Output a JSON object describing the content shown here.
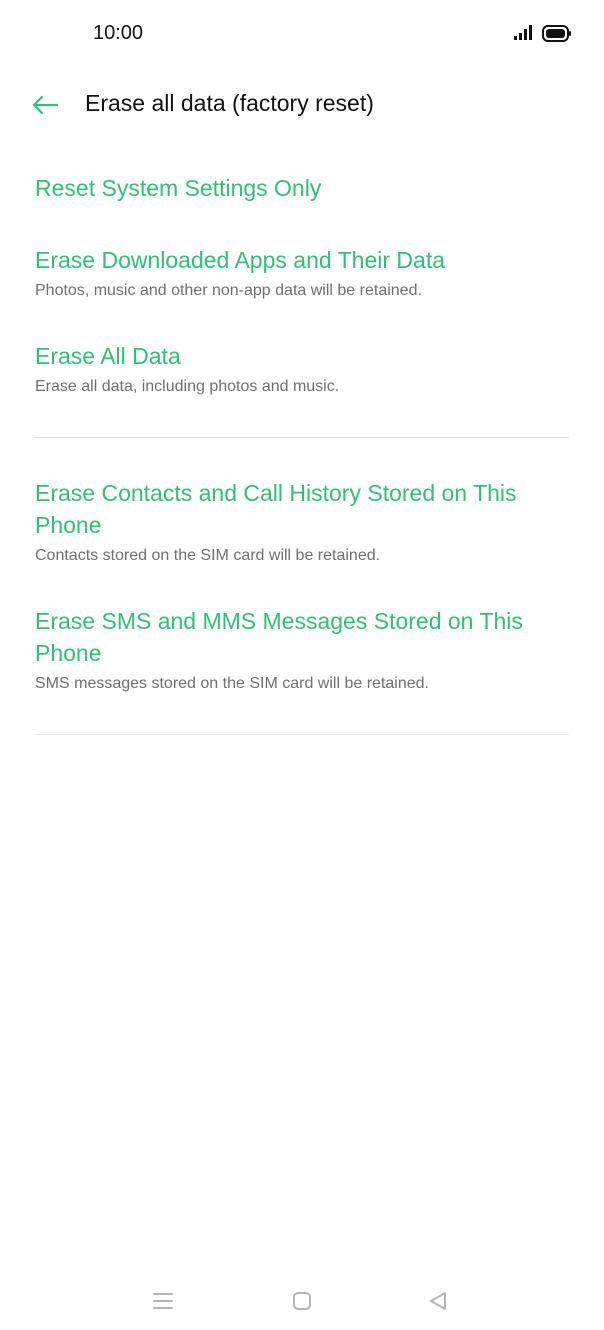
{
  "status_bar": {
    "time": "10:00",
    "icons": [
      "signal-icon",
      "battery-icon"
    ]
  },
  "header": {
    "title": "Erase all data (factory reset)",
    "back_icon": "arrow-left-icon"
  },
  "options": [
    {
      "title": "Reset System Settings Only",
      "description": ""
    },
    {
      "title": "Erase Downloaded Apps and Their Data",
      "description": "Photos, music and other non-app data will be retained."
    },
    {
      "title": "Erase All Data",
      "description": "Erase all data, including photos and music."
    },
    {
      "title": "Erase Contacts and Call History Stored on This Phone",
      "description": "Contacts stored on the SIM card will be retained."
    },
    {
      "title": "Erase SMS and MMS Messages Stored on This Phone",
      "description": "SMS messages stored on the SIM card will be retained."
    }
  ],
  "nav_bar": {
    "icons": [
      "menu-icon",
      "home-icon",
      "back-icon"
    ]
  },
  "colors": {
    "accent": "#2bc278",
    "title_text": "#111111",
    "secondary_text": "#6f6f6f",
    "divider": "#e3e3e3",
    "nav_icon": "#b5b5b5"
  }
}
